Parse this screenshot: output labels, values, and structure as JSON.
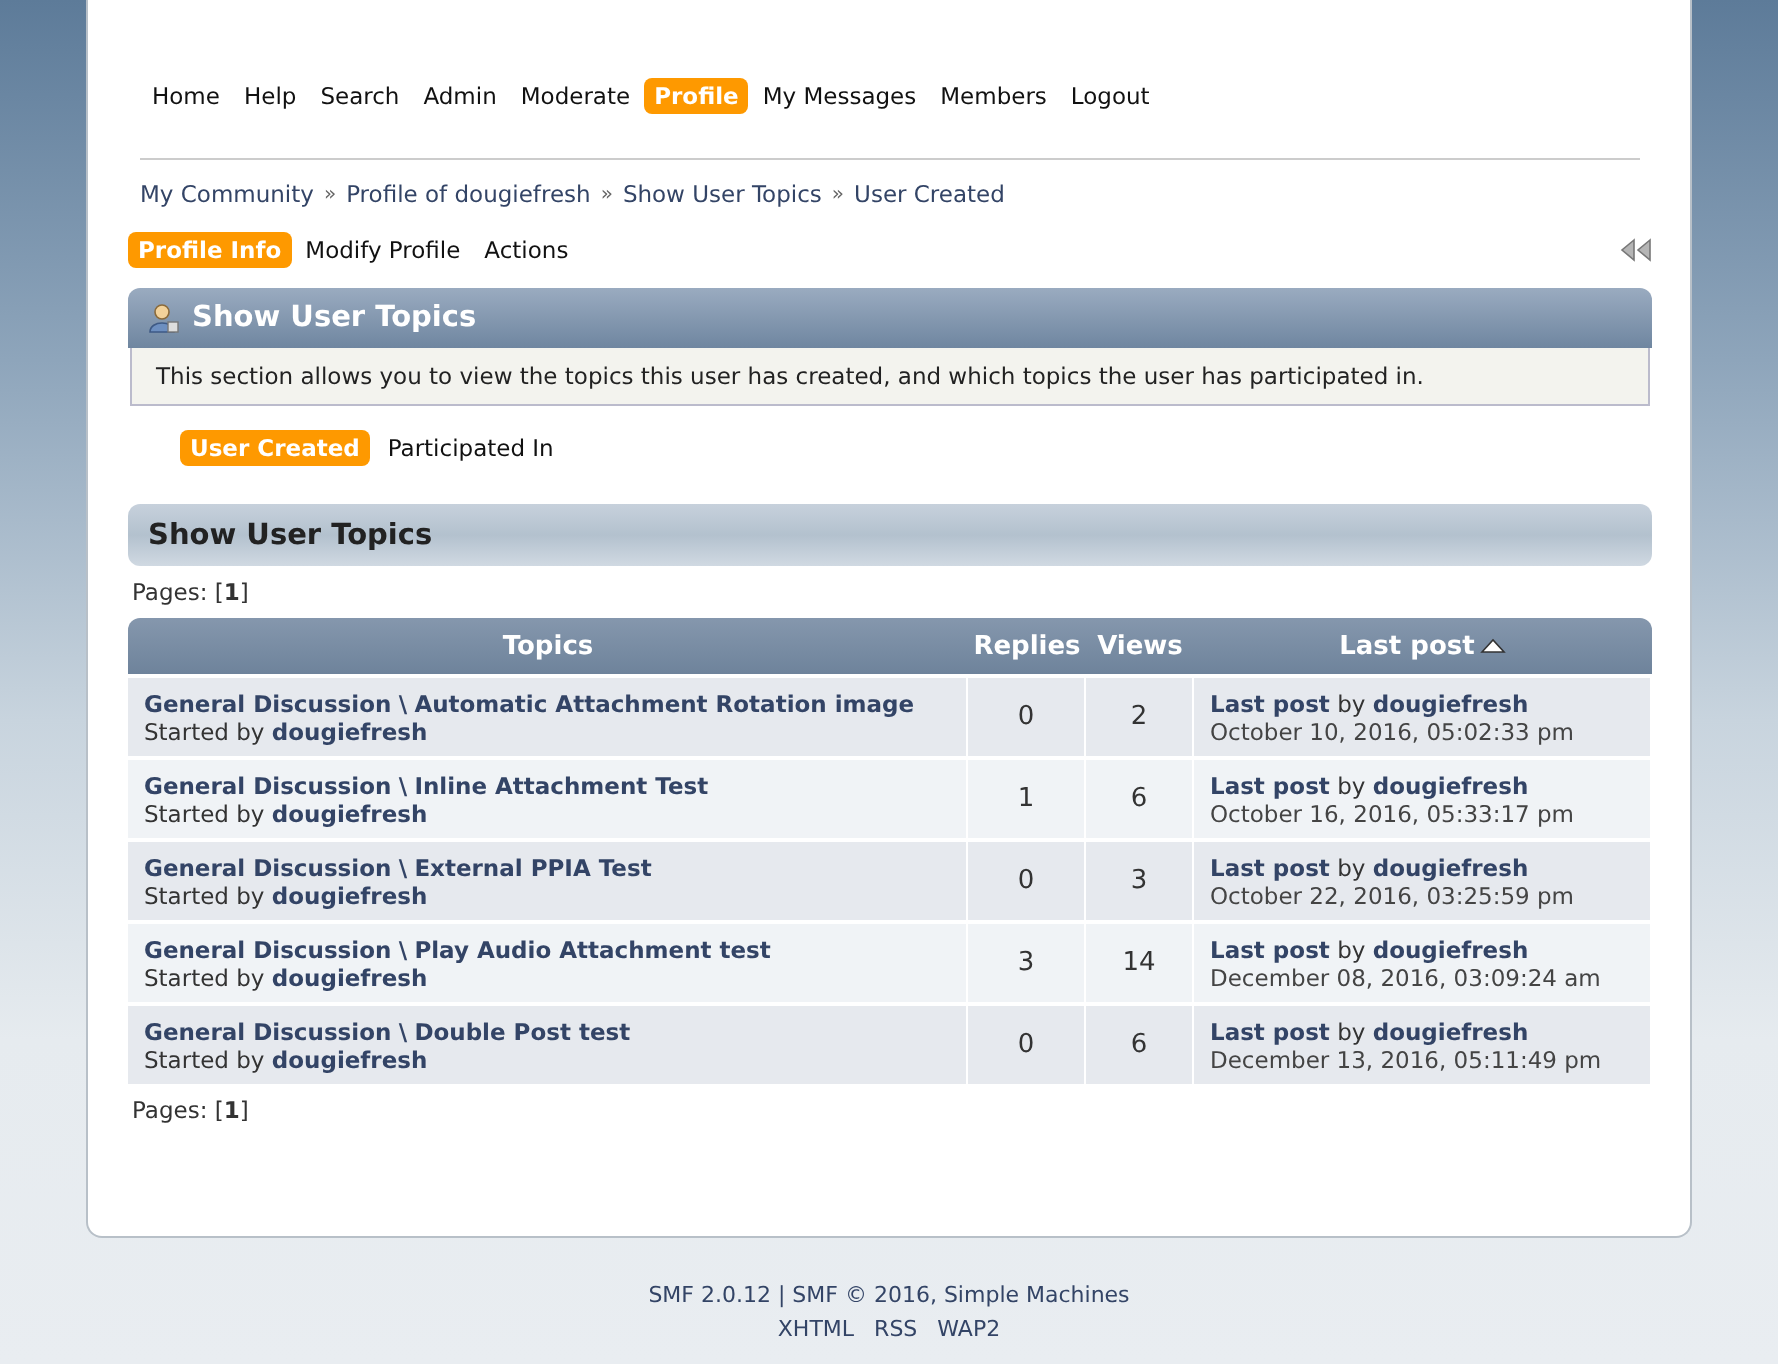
{
  "menu": [
    {
      "label": "Home",
      "selected": false
    },
    {
      "label": "Help",
      "selected": false
    },
    {
      "label": "Search",
      "selected": false
    },
    {
      "label": "Admin",
      "selected": false
    },
    {
      "label": "Moderate",
      "selected": false
    },
    {
      "label": "Profile",
      "selected": true
    },
    {
      "label": "My Messages",
      "selected": false
    },
    {
      "label": "Members",
      "selected": false
    },
    {
      "label": "Logout",
      "selected": false
    }
  ],
  "breadcrumb": {
    "items": [
      "My Community",
      "Profile of dougiefresh",
      "Show User Topics",
      "User Created"
    ],
    "separator": "»"
  },
  "profile_tabs": [
    {
      "label": "Profile Info",
      "selected": true
    },
    {
      "label": "Modify Profile",
      "selected": false
    },
    {
      "label": "Actions",
      "selected": false
    }
  ],
  "section": {
    "title": "Show User Topics",
    "description": "This section allows you to view the topics this user has created, and which topics the user has participated in."
  },
  "sub_tabs": [
    {
      "label": "User Created",
      "selected": true
    },
    {
      "label": "Participated In",
      "selected": false
    }
  ],
  "topics_header": {
    "title": "Show User Topics"
  },
  "pages_top": "Pages: [**1**]",
  "table": {
    "columns": [
      {
        "label": "Topics",
        "sorted": false
      },
      {
        "label": "Replies",
        "sorted": false
      },
      {
        "label": "Views",
        "sorted": false
      },
      {
        "label": "Last post",
        "sorted": true
      }
    ],
    "rows": [
      {
        "board": "General Discussion",
        "separator": "\\",
        "topic": "Automatic Attachment Rotation image",
        "started_label": "Started by",
        "starter": "dougiefresh",
        "replies": "0",
        "views": "2",
        "last_label": "Last post",
        "by": "by",
        "author": "dougiefresh",
        "date": "October 10, 2016, 05:02:33 pm"
      },
      {
        "board": "General Discussion",
        "separator": "\\",
        "topic": "Inline Attachment Test",
        "started_label": "Started by",
        "starter": "dougiefresh",
        "replies": "1",
        "views": "6",
        "last_label": "Last post",
        "by": "by",
        "author": "dougiefresh",
        "date": "October 16, 2016, 05:33:17 pm"
      },
      {
        "board": "General Discussion",
        "separator": "\\",
        "topic": "External PPIA Test",
        "started_label": "Started by",
        "starter": "dougiefresh",
        "replies": "0",
        "views": "3",
        "last_label": "Last post",
        "by": "by",
        "author": "dougiefresh",
        "date": "October 22, 2016, 03:25:59 pm"
      },
      {
        "board": "General Discussion",
        "separator": "\\",
        "topic": "Play Audio Attachment test",
        "started_label": "Started by",
        "starter": "dougiefresh",
        "replies": "3",
        "views": "14",
        "last_label": "Last post",
        "by": "by",
        "author": "dougiefresh",
        "date": "December 08, 2016, 03:09:24 am"
      },
      {
        "board": "General Discussion",
        "separator": "\\",
        "topic": "Double Post test",
        "started_label": "Started by",
        "starter": "dougiefresh",
        "replies": "0",
        "views": "6",
        "last_label": "Last post",
        "by": "by",
        "author": "dougiefresh",
        "date": "December 13, 2016, 05:11:49 pm"
      }
    ]
  },
  "pages_bottom": "Pages: [**1**]",
  "footer": {
    "copyright": "SMF 2.0.12 | SMF © 2016, Simple Machines",
    "links": [
      "XHTML",
      "RSS",
      "WAP2"
    ]
  }
}
